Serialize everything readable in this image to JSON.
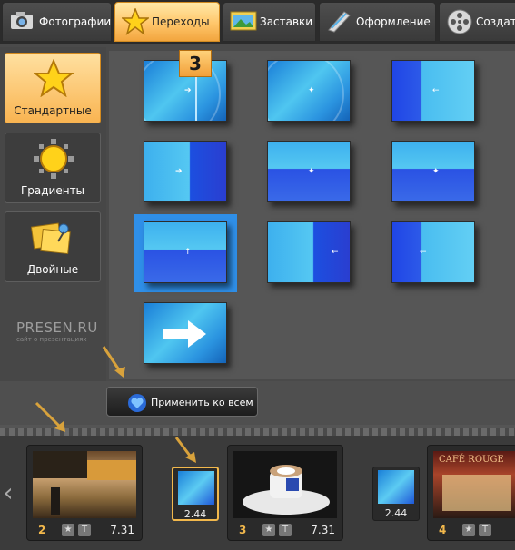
{
  "tabs": [
    {
      "label": "Фотографии",
      "icon": "camera-icon",
      "active": false
    },
    {
      "label": "Переходы",
      "icon": "star-icon",
      "active": true
    },
    {
      "label": "Заставки",
      "icon": "landscape-icon",
      "active": false
    },
    {
      "label": "Оформление",
      "icon": "brush-icon",
      "active": false
    },
    {
      "label": "Создат",
      "icon": "film-reel-icon",
      "active": false
    }
  ],
  "categories": [
    {
      "label": "Стандартные",
      "icon": "star-icon",
      "active": true
    },
    {
      "label": "Градиенты",
      "icon": "gradient-sun-icon",
      "active": false
    },
    {
      "label": "Двойные",
      "icon": "double-pin-icon",
      "active": false
    }
  ],
  "watermark": {
    "title": "PRESEN.RU",
    "subtitle": "сайт о презентациях"
  },
  "step_badge": "3",
  "apply_button": {
    "label": "Применить ко всем",
    "icon": "heart-icon"
  },
  "timeline": {
    "slides": [
      {
        "number": "2",
        "duration": "7.31",
        "star": "★",
        "text": "T"
      },
      {
        "number": "3",
        "duration": "7.31",
        "star": "★",
        "text": "T"
      },
      {
        "number": "4",
        "duration": "",
        "star": "★",
        "text": "T"
      }
    ],
    "transitions": [
      {
        "duration": "2.44",
        "selected": true
      },
      {
        "duration": "2.44",
        "selected": false
      }
    ],
    "cafe_sign": "CAFÉ ROUGE"
  },
  "colors": {
    "accent": "#f2b84c",
    "selection": "#2f8fe8",
    "annotation_arrow": "#d8a23c"
  }
}
